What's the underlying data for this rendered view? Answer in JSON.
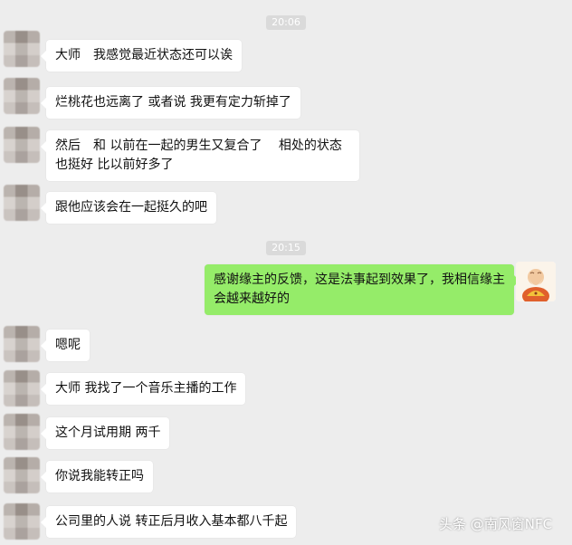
{
  "timestamps": [
    "20:06",
    "20:15"
  ],
  "messages": [
    {
      "from": "other",
      "text": "大师　我感觉最近状态还可以诶"
    },
    {
      "from": "other",
      "text": "烂桃花也远离了  或者说 我更有定力斩掉了"
    },
    {
      "from": "other",
      "text": "然后　和 以前在一起的男生又复合了　 相处的状态也挺好  比以前好多了"
    },
    {
      "from": "other",
      "text": "跟他应该会在一起挺久的吧"
    },
    {
      "from": "me",
      "text": "感谢缘主的反馈，这是法事起到效果了，我相信缘主会越来越好的"
    },
    {
      "from": "other",
      "text": "嗯呢"
    },
    {
      "from": "other",
      "text": "大师  我找了一个音乐主播的工作"
    },
    {
      "from": "other",
      "text": "这个月试用期  两千"
    },
    {
      "from": "other",
      "text": "你说我能转正吗"
    },
    {
      "from": "other",
      "text": "公司里的人说  转正后月收入基本都八千起"
    }
  ],
  "watermark": {
    "text": "头条 @南风窗NFC"
  },
  "icons": {
    "other_avatar": "blurred-avatar",
    "my_avatar": "monk-avatar"
  },
  "colors": {
    "background": "#ededed",
    "my_bubble": "#95ec69",
    "other_bubble": "#ffffff"
  }
}
